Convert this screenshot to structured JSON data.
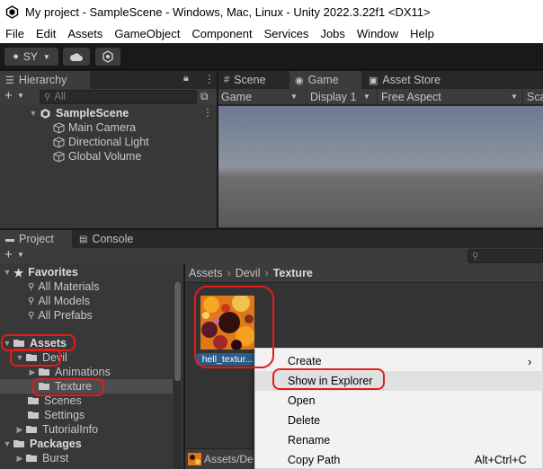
{
  "window": {
    "title": "My project - SampleScene - Windows, Mac, Linux - Unity 2022.3.22f1 <DX11>"
  },
  "menu": [
    "File",
    "Edit",
    "Assets",
    "GameObject",
    "Component",
    "Services",
    "Jobs",
    "Window",
    "Help"
  ],
  "toolbar": {
    "account_label": "SY"
  },
  "hierarchy": {
    "tab_label": "Hierarchy",
    "search_placeholder": "All",
    "scene_name": "SampleScene",
    "items": [
      "Main Camera",
      "Directional Light",
      "Global Volume"
    ]
  },
  "scene_tabs": {
    "scene": "Scene",
    "game": "Game",
    "asset_store": "Asset Store"
  },
  "game_toolbar": {
    "mode": "Game",
    "display": "Display 1",
    "aspect": "Free Aspect",
    "scale": "Sca"
  },
  "bottom_tabs": {
    "project": "Project",
    "console": "Console"
  },
  "project_tree": {
    "favorites_label": "Favorites",
    "favorites": [
      "All Materials",
      "All Models",
      "All Prefabs"
    ],
    "assets_label": "Assets",
    "devil_label": "Devil",
    "devil_children": [
      "Animations",
      "Texture"
    ],
    "assets_children": [
      "Scenes",
      "Settings",
      "TutorialInfo"
    ],
    "packages_label": "Packages",
    "packages_children": [
      "Burst"
    ]
  },
  "breadcrumb": {
    "root": "Assets",
    "mid": "Devil",
    "leaf": "Texture"
  },
  "asset": {
    "name": "hell_textur..."
  },
  "bottom_path": "Assets/De",
  "context_menu": {
    "items": [
      "Create",
      "Show in Explorer",
      "Open",
      "Delete",
      "Rename",
      "Copy Path"
    ],
    "copy_path_shortcut": "Alt+Ctrl+C"
  },
  "colors": {
    "annotation_red": "#e31b1b",
    "selection_blue": "#2c5d87",
    "panel_bg": "#383838"
  }
}
